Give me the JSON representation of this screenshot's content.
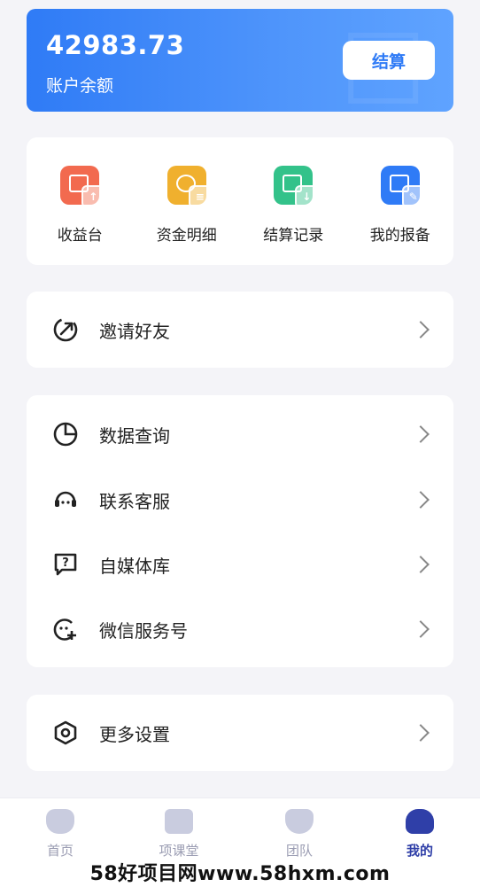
{
  "balance": {
    "amount": "42983.73",
    "label": "账户余额",
    "settle_label": "结算",
    "accent": "#2f7bf6"
  },
  "quick_actions": [
    {
      "label": "收益台",
      "icon": "income-icon",
      "color": "#f26a4f"
    },
    {
      "label": "资金明细",
      "icon": "funds-detail-icon",
      "color": "#f0b02e"
    },
    {
      "label": "结算记录",
      "icon": "settlement-record-icon",
      "color": "#33c28a"
    },
    {
      "label": "我的报备",
      "icon": "my-report-icon",
      "color": "#2f7bf6"
    }
  ],
  "invite": {
    "label": "邀请好友",
    "icon": "invite-arrow-icon"
  },
  "menu": [
    {
      "label": "数据查询",
      "icon": "pie-chart-icon"
    },
    {
      "label": "联系客服",
      "icon": "headset-icon"
    },
    {
      "label": "自媒体库",
      "icon": "question-chat-icon"
    },
    {
      "label": "微信服务号",
      "icon": "wechat-add-icon"
    }
  ],
  "settings": {
    "label": "更多设置",
    "icon": "hexagon-gear-icon"
  },
  "tabs": [
    {
      "label": "首页",
      "icon": "home-icon",
      "active": false
    },
    {
      "label": "项课堂",
      "icon": "class-icon",
      "active": false
    },
    {
      "label": "团队",
      "icon": "team-icon",
      "active": false
    },
    {
      "label": "我的",
      "icon": "profile-icon",
      "active": true
    }
  ],
  "footer_watermark": "58好项目网www.58hxm.com"
}
